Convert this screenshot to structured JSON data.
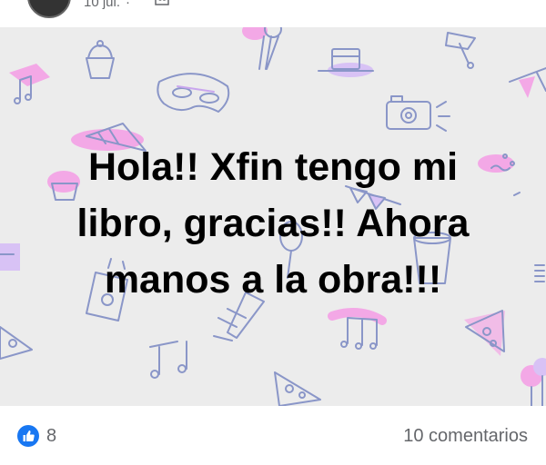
{
  "post": {
    "date": "10 jul.",
    "separator": "·",
    "audience_icon": "friends-audience-icon",
    "text_line1": "Hola!! Xfin tengo mi",
    "text_line2": "libro, gracias!! Ahora",
    "text_line3": "manos a la obra!!!",
    "background_color": "#ececec"
  },
  "reactions": {
    "like_icon": "like-thumb-icon",
    "like_color": "#1877f2",
    "count": "8",
    "comments": "10 comentarios"
  }
}
